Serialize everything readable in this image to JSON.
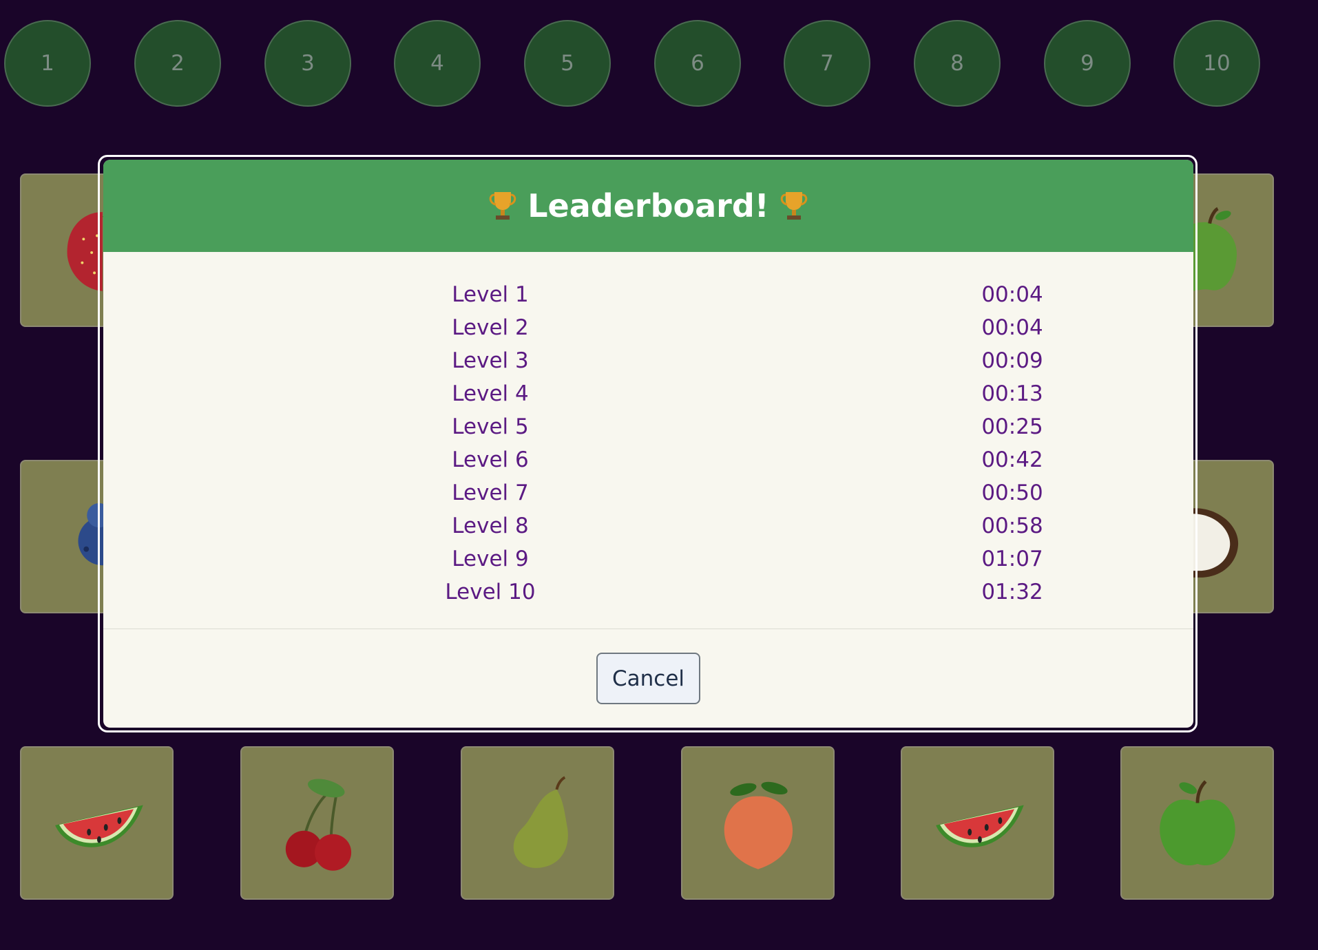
{
  "levels": [
    "1",
    "2",
    "3",
    "4",
    "5",
    "6",
    "7",
    "8",
    "9",
    "10"
  ],
  "cards": {
    "top_left_fruit": "strawberry",
    "top_right_fruit": "green-apple",
    "mid_left_fruit": "blueberry",
    "mid_right_fruit": "coconut",
    "bottom_row": [
      "watermelon",
      "cherries",
      "pear",
      "peach",
      "watermelon",
      "green-apple"
    ]
  },
  "modal": {
    "title": "Leaderboard!",
    "trophy_icon": "trophy-icon",
    "rows": [
      {
        "level": "Level 1",
        "time": "00:04"
      },
      {
        "level": "Level 2",
        "time": "00:04"
      },
      {
        "level": "Level 3",
        "time": "00:09"
      },
      {
        "level": "Level 4",
        "time": "00:13"
      },
      {
        "level": "Level 5",
        "time": "00:25"
      },
      {
        "level": "Level 6",
        "time": "00:42"
      },
      {
        "level": "Level 7",
        "time": "00:50"
      },
      {
        "level": "Level 8",
        "time": "00:58"
      },
      {
        "level": "Level 9",
        "time": "01:07"
      },
      {
        "level": "Level 10",
        "time": "01:32"
      }
    ],
    "cancel_label": "Cancel"
  },
  "colors": {
    "background": "#1a0529",
    "level_circle": "#234e2b",
    "card": "#7f7f51",
    "header": "#4a9e5a",
    "modal_body": "#f8f7ef",
    "row_text": "#5b1a83"
  }
}
